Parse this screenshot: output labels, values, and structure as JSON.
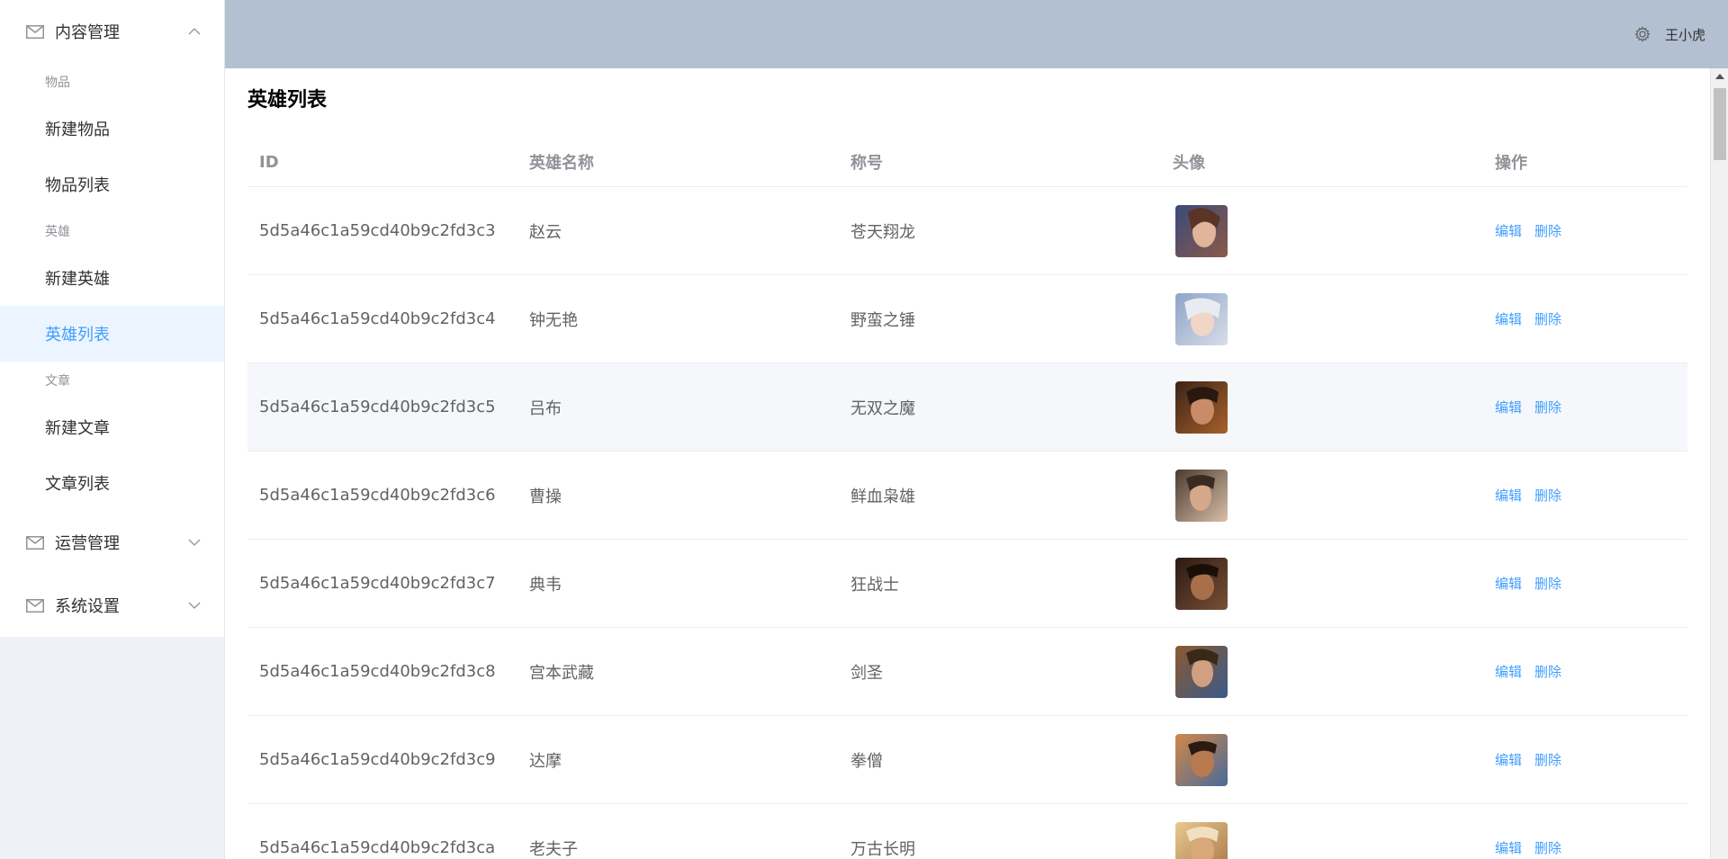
{
  "sidebar": {
    "menus": [
      {
        "title": "内容管理",
        "icon": "mail-icon",
        "expanded": true
      },
      {
        "title": "运营管理",
        "icon": "mail-icon",
        "expanded": false
      },
      {
        "title": "系统设置",
        "icon": "mail-icon",
        "expanded": false
      }
    ],
    "groups": {
      "items": "物品",
      "heroes": "英雄",
      "articles": "文章"
    },
    "links": {
      "new_item": "新建物品",
      "item_list": "物品列表",
      "new_hero": "新建英雄",
      "hero_list": "英雄列表",
      "new_article": "新建文章",
      "article_list": "文章列表"
    },
    "active": "英雄列表"
  },
  "header": {
    "username": "王小虎",
    "icon": "gear-icon"
  },
  "page": {
    "title": "英雄列表"
  },
  "table": {
    "columns": [
      "ID",
      "英雄名称",
      "称号",
      "头像",
      "操作"
    ],
    "rows": [
      {
        "id": "5d5a46c1a59cd40b9c2fd3c3",
        "name": "赵云",
        "title": "苍天翔龙",
        "edit": "编辑",
        "delete": "删除"
      },
      {
        "id": "5d5a46c1a59cd40b9c2fd3c4",
        "name": "钟无艳",
        "title": "野蛮之锤",
        "edit": "编辑",
        "delete": "删除"
      },
      {
        "id": "5d5a46c1a59cd40b9c2fd3c5",
        "name": "吕布",
        "title": "无双之魔",
        "edit": "编辑",
        "delete": "删除"
      },
      {
        "id": "5d5a46c1a59cd40b9c2fd3c6",
        "name": "曹操",
        "title": "鲜血枭雄",
        "edit": "编辑",
        "delete": "删除"
      },
      {
        "id": "5d5a46c1a59cd40b9c2fd3c7",
        "name": "典韦",
        "title": "狂战士",
        "edit": "编辑",
        "delete": "删除"
      },
      {
        "id": "5d5a46c1a59cd40b9c2fd3c8",
        "name": "宫本武藏",
        "title": "剑圣",
        "edit": "编辑",
        "delete": "删除"
      },
      {
        "id": "5d5a46c1a59cd40b9c2fd3c9",
        "name": "达摩",
        "title": "拳僧",
        "edit": "编辑",
        "delete": "删除"
      },
      {
        "id": "5d5a46c1a59cd40b9c2fd3ca",
        "name": "老夫子",
        "title": "万古长明",
        "edit": "编辑",
        "delete": "删除"
      }
    ]
  },
  "colors": {
    "header_bg": "#b3c0d1",
    "active": "#409eff",
    "sidebar_bg": "#eef1f6"
  }
}
